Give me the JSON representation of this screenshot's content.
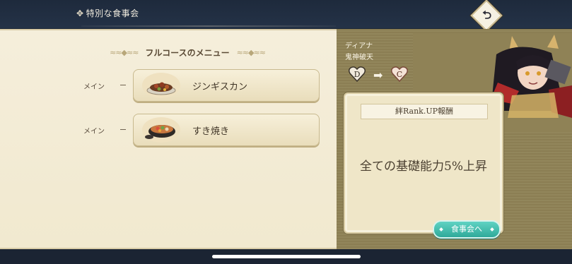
{
  "header": {
    "title_icon": "✥",
    "title": "特別な食事会",
    "back_icon": "return-arrow-icon"
  },
  "menu": {
    "heading": "フルコースのメニュー",
    "courses": [
      {
        "label": "メイン",
        "dish": "ジンギスカン",
        "image": "jingisukan-dish-image"
      },
      {
        "label": "メイン",
        "dish": "すき焼き",
        "image": "sukiyaki-dish-image"
      }
    ]
  },
  "character": {
    "name": "ディアナ",
    "title": "鬼神破天",
    "rank_from": "D",
    "rank_to": "C"
  },
  "reward": {
    "heading": "絆Rank.UP報酬",
    "text": "全ての基礎能力5%上昇",
    "button_label": "食事会へ"
  },
  "colors": {
    "accent_button": "#2fa99a",
    "panel_bg": "#f1e9cf",
    "right_panel_bg": "#8f8256"
  }
}
